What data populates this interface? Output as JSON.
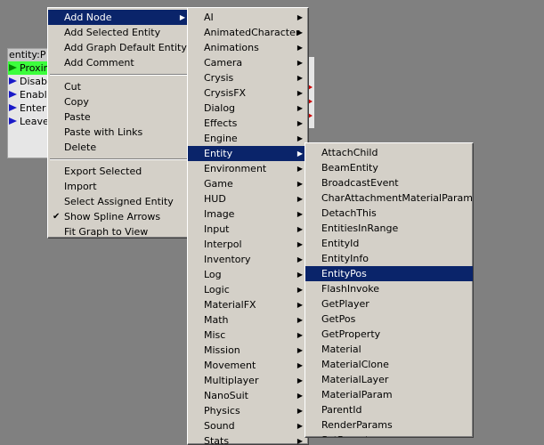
{
  "graph_node": {
    "title": "entity:P",
    "ports": [
      "Proxim",
      "Disabl",
      "Enabl",
      "Enter",
      "Leave"
    ]
  },
  "context_menu": {
    "groups": [
      [
        {
          "label": "Add Node",
          "submenu": true,
          "selected": true
        },
        {
          "label": "Add Selected Entity"
        },
        {
          "label": "Add Graph Default Entity"
        },
        {
          "label": "Add Comment"
        }
      ],
      [
        {
          "label": "Cut"
        },
        {
          "label": "Copy"
        },
        {
          "label": "Paste"
        },
        {
          "label": "Paste with Links"
        },
        {
          "label": "Delete"
        }
      ],
      [
        {
          "label": "Export Selected"
        },
        {
          "label": "Import"
        },
        {
          "label": "Select Assigned Entity"
        },
        {
          "label": "Show Spline Arrows",
          "checked": true
        },
        {
          "label": "Fit Graph to View"
        }
      ]
    ]
  },
  "category_menu": {
    "items": [
      "AI",
      "AnimatedCharacter",
      "Animations",
      "Camera",
      "Crysis",
      "CrysisFX",
      "Dialog",
      "Effects",
      "Engine",
      "Entity",
      "Environment",
      "Game",
      "HUD",
      "Image",
      "Input",
      "Interpol",
      "Inventory",
      "Log",
      "Logic",
      "MaterialFX",
      "Math",
      "Misc",
      "Mission",
      "Movement",
      "Multiplayer",
      "NanoSuit",
      "Physics",
      "Sound",
      "Stats"
    ],
    "selected": "Entity"
  },
  "entity_menu": {
    "items": [
      "AttachChild",
      "BeamEntity",
      "BroadcastEvent",
      "CharAttachmentMaterialParam",
      "DetachThis",
      "EntitiesInRange",
      "EntityId",
      "EntityInfo",
      "EntityPos",
      "FlashInvoke",
      "GetPlayer",
      "GetPos",
      "GetProperty",
      "Material",
      "MaterialClone",
      "MaterialLayer",
      "MaterialParam",
      "ParentId",
      "RenderParams",
      "SetParent"
    ],
    "selected": "EntityPos"
  }
}
